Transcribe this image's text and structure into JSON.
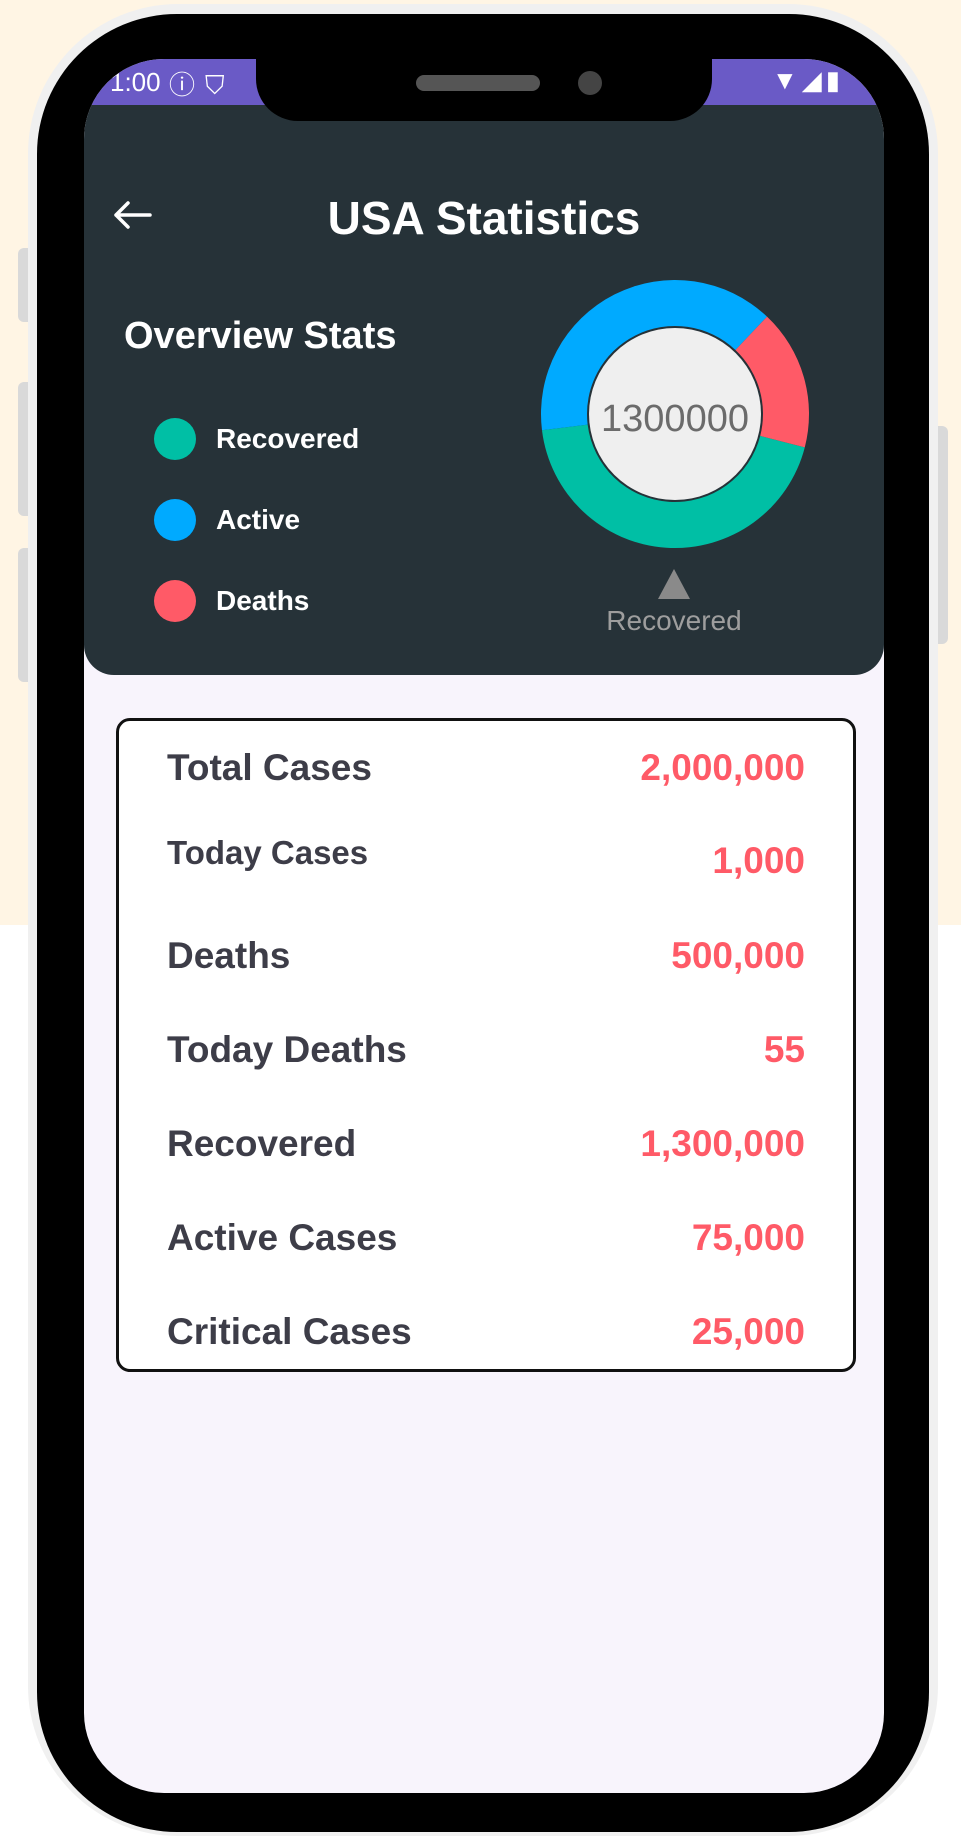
{
  "status_bar": {
    "time": "1:00",
    "left_icons": [
      "info-icon",
      "shield-icon"
    ],
    "right_icons": [
      "wifi-icon",
      "signal-icon",
      "battery-icon"
    ],
    "color": "#6a5ac6"
  },
  "header": {
    "title": "USA Statistics",
    "back_icon": "arrow-left-icon"
  },
  "overview": {
    "title": "Overview Stats",
    "legend": [
      {
        "label": "Recovered",
        "color": "#00bfa5"
      },
      {
        "label": "Active",
        "color": "#00aaff"
      },
      {
        "label": "Deaths",
        "color": "#ff5a67"
      }
    ]
  },
  "chart_data": {
    "type": "pie",
    "center_label": "1300000",
    "selected_label": "Recovered",
    "slices": [
      {
        "label": "Recovered",
        "value": 1300000,
        "color": "#00bfa5"
      },
      {
        "label": "Active",
        "value": 1150000,
        "color": "#00aaff"
      },
      {
        "label": "Deaths",
        "value": 500000,
        "color": "#ff5a67"
      }
    ]
  },
  "stats": [
    {
      "label": "Total Cases",
      "value": "2,000,000"
    },
    {
      "label": "Today Cases",
      "value": "1,000"
    },
    {
      "label": "Deaths",
      "value": "500,000"
    },
    {
      "label": "Today Deaths",
      "value": "55"
    },
    {
      "label": "Recovered",
      "value": "1,300,000"
    },
    {
      "label": "Active Cases",
      "value": "75,000"
    },
    {
      "label": "Critical Cases",
      "value": "25,000"
    }
  ],
  "colors": {
    "page_background": "#fff5e4",
    "header_background": "#263238",
    "value_text": "#ff5a67",
    "screen_background": "#f8f4fc"
  }
}
